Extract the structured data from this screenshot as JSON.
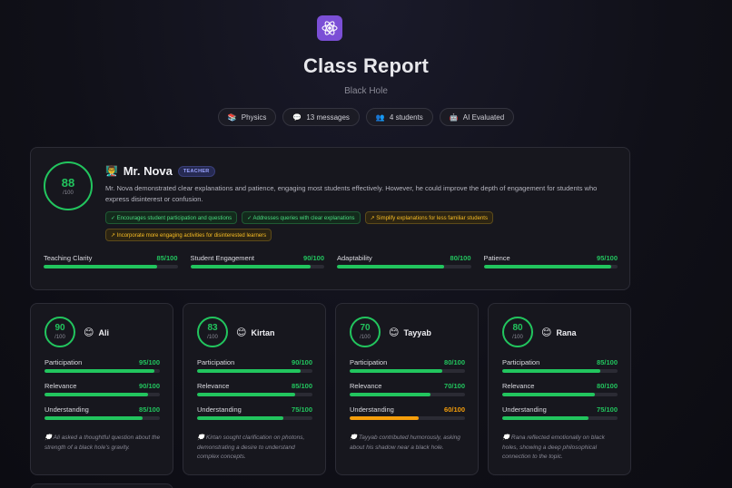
{
  "header": {
    "logo_icon": "atom-icon",
    "title": "Class Report",
    "subtitle": "Black Hole",
    "pills": [
      {
        "icon": "books-icon",
        "glyph": "📚",
        "label": "Physics"
      },
      {
        "icon": "speech-bubble-icon",
        "glyph": "💬",
        "label": "13 messages"
      },
      {
        "icon": "people-icon",
        "glyph": "👥",
        "label": "4 students"
      },
      {
        "icon": "robot-icon",
        "glyph": "🤖",
        "label": "AI Evaluated"
      }
    ]
  },
  "teacher": {
    "score": "88",
    "score_max": "/100",
    "emoji": "👨‍🏫",
    "name": "Mr. Nova",
    "badge": "TEACHER",
    "summary": "Mr. Nova demonstrated clear explanations and patience, engaging most students effectively. However, he could improve the depth of engagement for students who express disinterest or confusion.",
    "strengths": [
      "✓ Encourages student participation and questions",
      "✓ Addresses queries with clear explanations"
    ],
    "improvements": [
      "↗ Simplify explanations for less familiar students",
      "↗ Incorporate more engaging activities for disinterested learners"
    ],
    "metrics": [
      {
        "label": "Teaching Clarity",
        "value": "85/100",
        "pct": 85
      },
      {
        "label": "Student Engagement",
        "value": "90/100",
        "pct": 90
      },
      {
        "label": "Adaptability",
        "value": "80/100",
        "pct": 80
      },
      {
        "label": "Patience",
        "value": "95/100",
        "pct": 95
      }
    ]
  },
  "students": [
    {
      "score": "90",
      "score_max": "/100",
      "emoji": "😊",
      "name": "Ali",
      "metrics": [
        {
          "label": "Participation",
          "value": "95/100",
          "pct": 95,
          "color": "green"
        },
        {
          "label": "Relevance",
          "value": "90/100",
          "pct": 90,
          "color": "green"
        },
        {
          "label": "Understanding",
          "value": "85/100",
          "pct": 85,
          "color": "green"
        }
      ],
      "note": "💭 Ali asked a thoughtful question about the strength of a black hole's gravity."
    },
    {
      "score": "83",
      "score_max": "/100",
      "emoji": "😊",
      "name": "Kirtan",
      "metrics": [
        {
          "label": "Participation",
          "value": "90/100",
          "pct": 90,
          "color": "green"
        },
        {
          "label": "Relevance",
          "value": "85/100",
          "pct": 85,
          "color": "green"
        },
        {
          "label": "Understanding",
          "value": "75/100",
          "pct": 75,
          "color": "green"
        }
      ],
      "note": "💭 Kirtan sought clarification on photons, demonstrating a desire to understand complex concepts."
    },
    {
      "score": "70",
      "score_max": "/100",
      "emoji": "😊",
      "name": "Tayyab",
      "metrics": [
        {
          "label": "Participation",
          "value": "80/100",
          "pct": 80,
          "color": "green"
        },
        {
          "label": "Relevance",
          "value": "70/100",
          "pct": 70,
          "color": "green"
        },
        {
          "label": "Understanding",
          "value": "60/100",
          "pct": 60,
          "color": "amber"
        }
      ],
      "note": "💭 Tayyab contributed humorously, asking about his shadow near a black hole."
    },
    {
      "score": "80",
      "score_max": "/100",
      "emoji": "😊",
      "name": "Rana",
      "metrics": [
        {
          "label": "Participation",
          "value": "85/100",
          "pct": 85,
          "color": "green"
        },
        {
          "label": "Relevance",
          "value": "80/100",
          "pct": 80,
          "color": "green"
        },
        {
          "label": "Understanding",
          "value": "75/100",
          "pct": 75,
          "color": "green"
        }
      ],
      "note": "💭 Rana reflected emotionally on black holes, showing a deep philosophical connection to the topic."
    }
  ],
  "colors": {
    "good": "#22c55e",
    "warn": "#f59e0b",
    "brand": "#7b4fd6"
  }
}
